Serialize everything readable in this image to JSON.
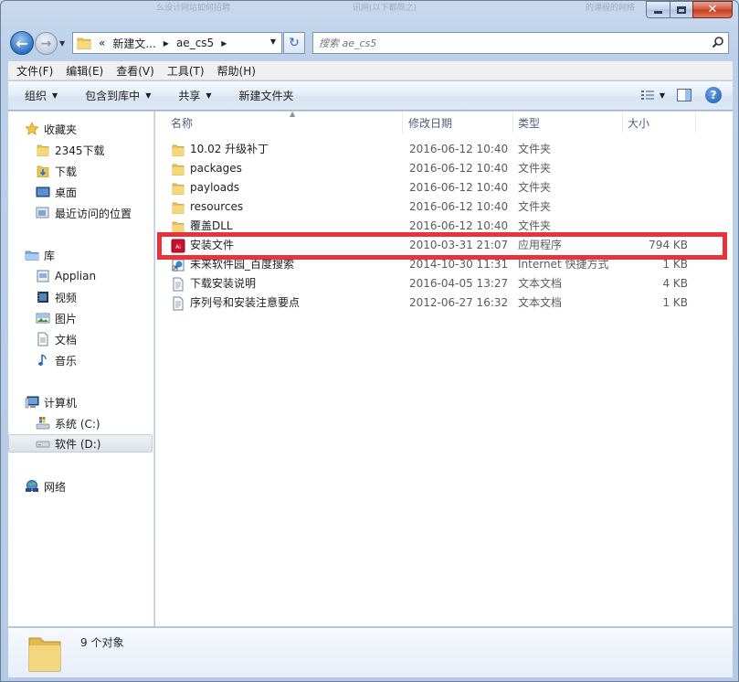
{
  "window": {
    "ghost_titles": [
      "么设计网站如何招聘",
      "讯网(以下都简之)",
      "的课程的网络流于"
    ]
  },
  "caption": {
    "minimize": "▭",
    "maximize": "□",
    "close": "✕"
  },
  "address": {
    "prefix": "«",
    "crumbs": [
      "新建文...",
      "ae_cs5"
    ],
    "refresh_glyph": "↻"
  },
  "search": {
    "placeholder": "搜索 ae_cs5"
  },
  "menu": [
    "文件(F)",
    "编辑(E)",
    "查看(V)",
    "工具(T)",
    "帮助(H)"
  ],
  "toolbar": {
    "organize": "组织",
    "include_in_library": "包含到库中",
    "share": "共享",
    "new_folder": "新建文件夹"
  },
  "nav": {
    "favorites": "收藏夹",
    "fav_items": [
      "2345下载",
      "下载",
      "桌面",
      "最近访问的位置"
    ],
    "libraries": "库",
    "lib_items": [
      "Applian",
      "视频",
      "图片",
      "文档",
      "音乐"
    ],
    "computer": "计算机",
    "drives": [
      "系统 (C:)",
      "软件 (D:)"
    ],
    "network": "网络"
  },
  "columns": {
    "name": "名称",
    "date": "修改日期",
    "type": "类型",
    "size": "大小"
  },
  "files": [
    {
      "name": "10.02 升级补丁",
      "date": "2016-06-12 10:40",
      "type": "文件夹",
      "size": "",
      "icon": "folder-icon"
    },
    {
      "name": "packages",
      "date": "2016-06-12 10:40",
      "type": "文件夹",
      "size": "",
      "icon": "folder-icon"
    },
    {
      "name": "payloads",
      "date": "2016-06-12 10:40",
      "type": "文件夹",
      "size": "",
      "icon": "folder-icon"
    },
    {
      "name": "resources",
      "date": "2016-06-12 10:40",
      "type": "文件夹",
      "size": "",
      "icon": "folder-icon"
    },
    {
      "name": "覆盖DLL",
      "date": "2016-06-12 10:40",
      "type": "文件夹",
      "size": "",
      "icon": "folder-icon"
    },
    {
      "name": "安装文件",
      "date": "2010-03-31 21:07",
      "type": "应用程序",
      "size": "794 KB",
      "icon": "adobe-app-icon"
    },
    {
      "name": "未来软件园_百度搜索",
      "date": "2014-10-30 11:31",
      "type": "Internet 快捷方式",
      "size": "1 KB",
      "icon": "shortcut-icon"
    },
    {
      "name": "下载安装说明",
      "date": "2016-04-05 13:27",
      "type": "文本文档",
      "size": "4 KB",
      "icon": "text-file-icon"
    },
    {
      "name": "序列号和安装注意要点",
      "date": "2012-06-27 16:32",
      "type": "文本文档",
      "size": "1 KB",
      "icon": "text-file-icon"
    }
  ],
  "details": {
    "count": "9 个对象"
  },
  "colors": {
    "highlight": "#e8333b",
    "window": "#c9d9ee"
  }
}
